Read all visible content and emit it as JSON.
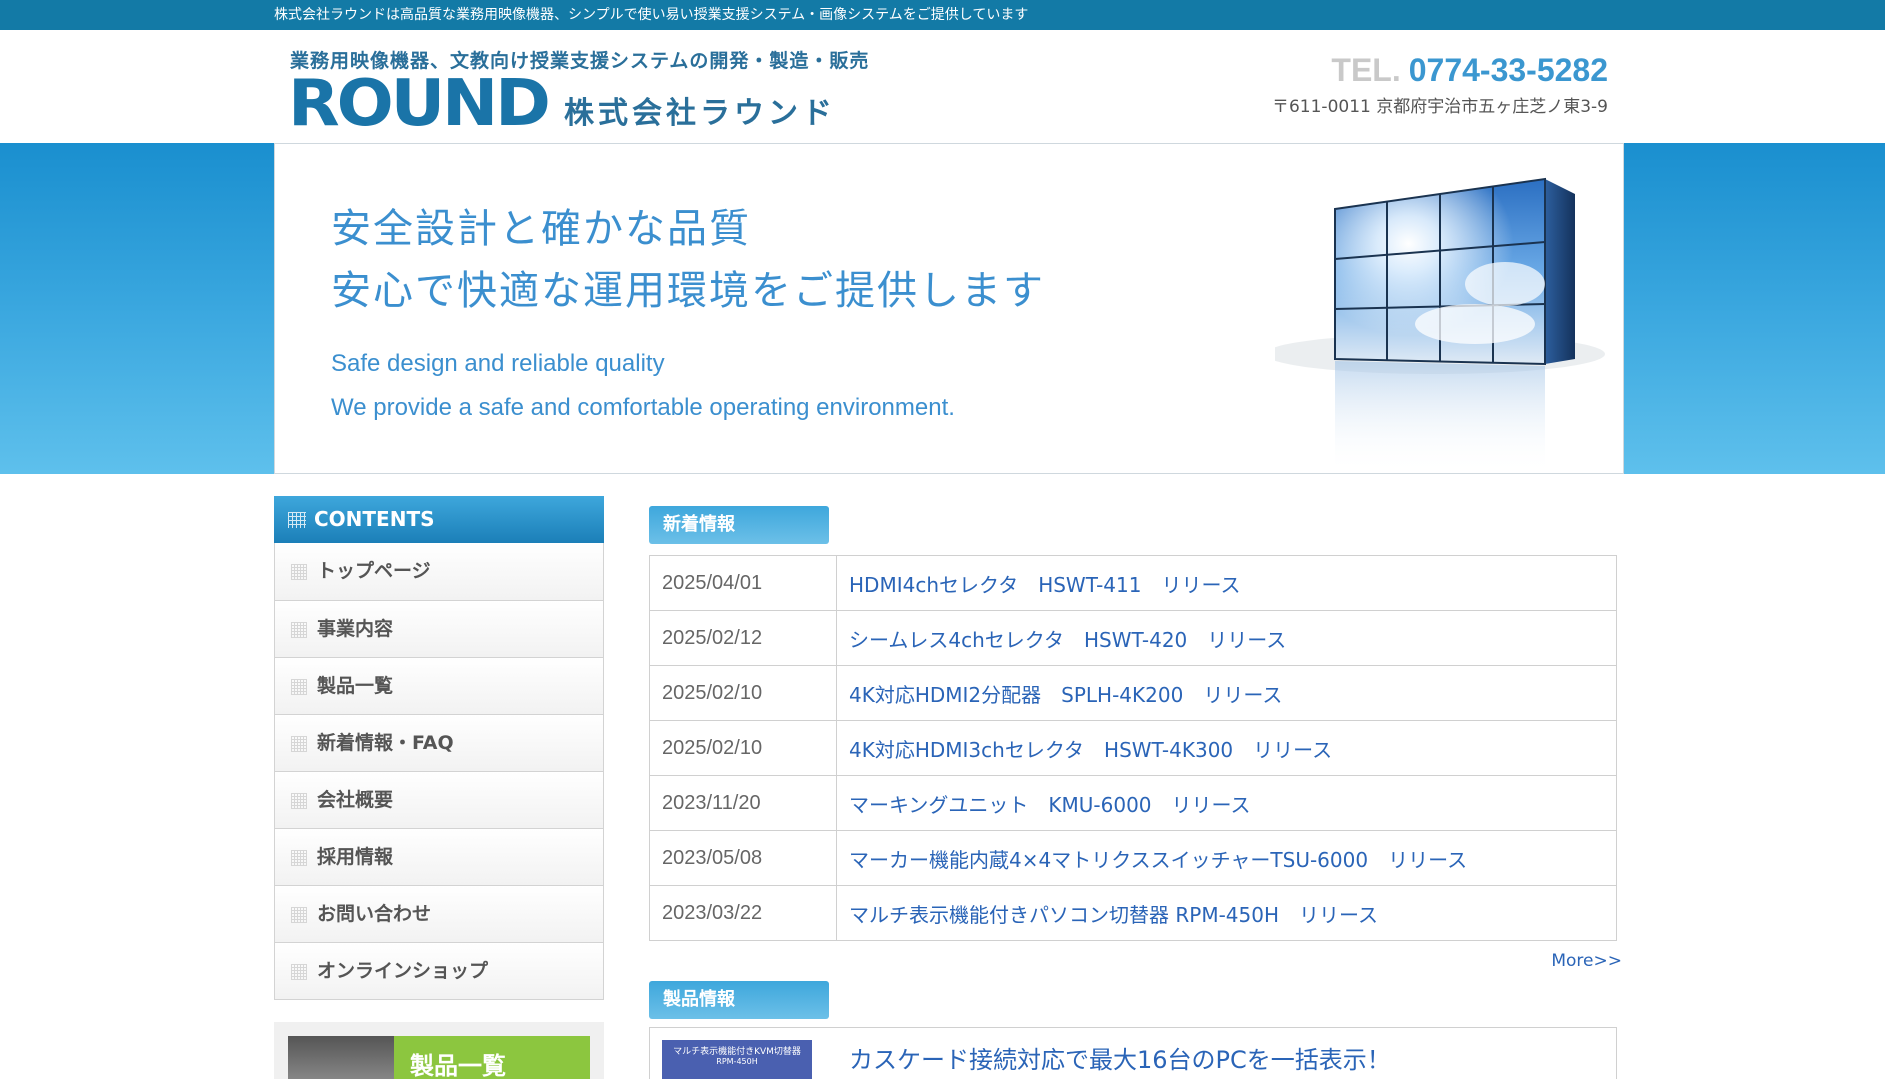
{
  "topbar": {
    "text": "株式会社ラウンドは高品質な業務用映像機器、シンプルで使い易い授業支援システム・画像システムをご提供しています"
  },
  "header": {
    "tagline": "業務用映像機器、文教向け授業支援システムの開発・製造・販売",
    "logo": "ROUND",
    "company": "株式会社ラウンド",
    "tel_label": "TEL.",
    "tel_number": "0774-33-5282",
    "address": "〒611-0011 京都府宇治市五ヶ庄芝ノ東3-9"
  },
  "hero": {
    "jp_line1": "安全設計と確かな品質",
    "jp_line2": "安心で快適な運用環境をご提供します",
    "en_line1": "Safe design and reliable quality",
    "en_line2": "We provide a safe and comfortable operating environment."
  },
  "sidebar": {
    "heading": "CONTENTS",
    "items": [
      {
        "label": "トップページ"
      },
      {
        "label": "事業内容"
      },
      {
        "label": "製品一覧"
      },
      {
        "label": "新着情報・FAQ"
      },
      {
        "label": "会社概要"
      },
      {
        "label": "採用情報"
      },
      {
        "label": "お問い合わせ"
      },
      {
        "label": "オンラインショップ"
      }
    ],
    "banner_text": "製品一覧"
  },
  "news": {
    "heading": "新着情報",
    "rows": [
      {
        "date": "2025/04/01",
        "title": "HDMI4chセレクタ　HSWT-411　リリース"
      },
      {
        "date": "2025/02/12",
        "title": "シームレス4chセレクタ　HSWT-420　リリース"
      },
      {
        "date": "2025/02/10",
        "title": "4K対応HDMI2分配器　SPLH-4K200　リリース"
      },
      {
        "date": "2025/02/10",
        "title": "4K対応HDMI3chセレクタ　HSWT-4K300　リリース"
      },
      {
        "date": "2023/11/20",
        "title": "マーキングユニット　KMU-6000　リリース"
      },
      {
        "date": "2023/05/08",
        "title": "マーカー機能内蔵4×4マトリクススイッチャーTSU-6000　リリース"
      },
      {
        "date": "2023/03/22",
        "title": "マルチ表示機能付きパソコン切替器 RPM-450H　リリース"
      }
    ],
    "more": "More>>"
  },
  "products": {
    "heading": "製品情報",
    "thumb_line1": "マルチ表示機能付きKVM切替器",
    "thumb_line2": "RPM-450H",
    "title": "カスケード接続対応で最大16台のPCを一括表示！"
  }
}
